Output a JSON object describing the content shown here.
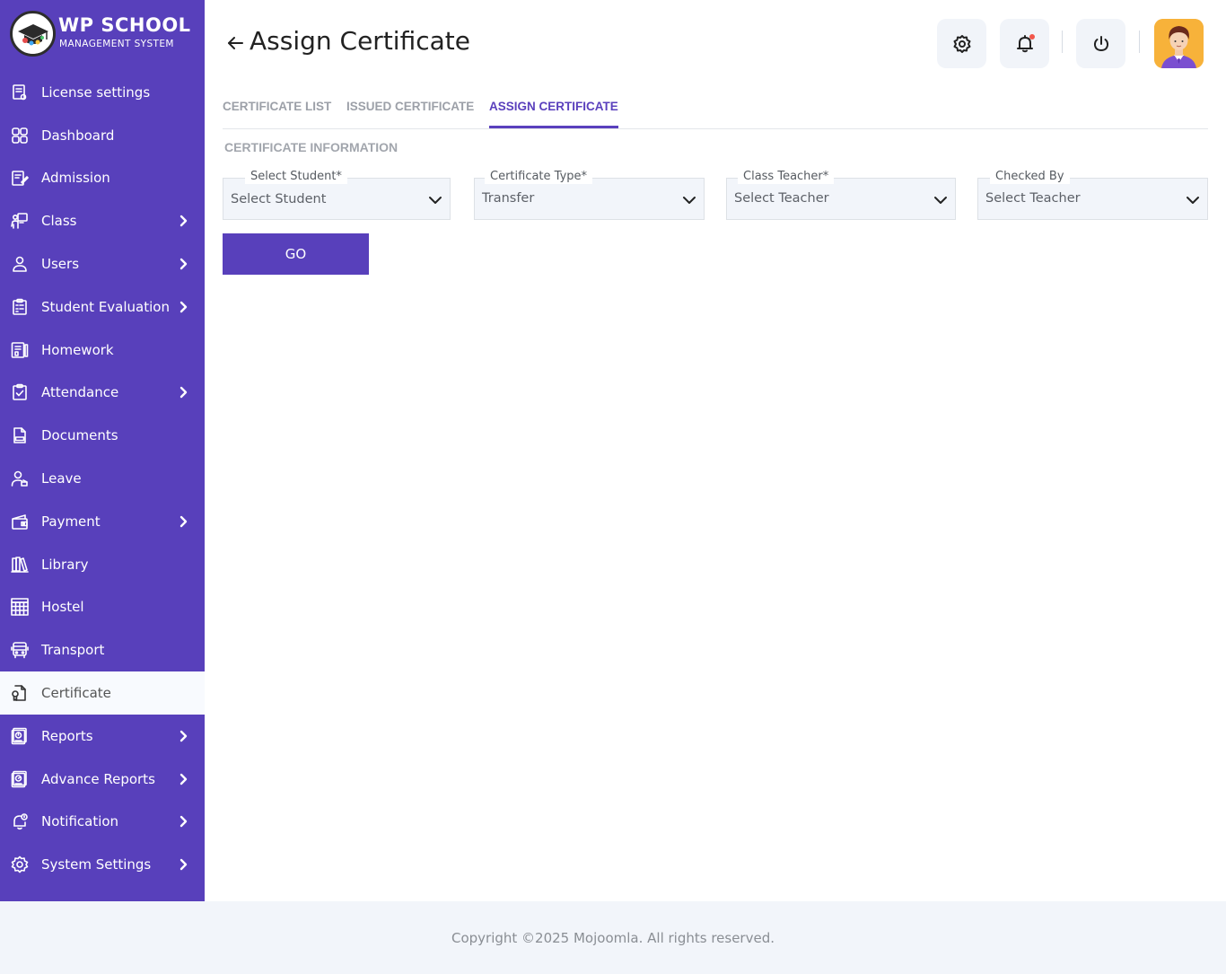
{
  "brand": {
    "title": "WP SCHOOL",
    "subtitle": "MANAGEMENT SYSTEM"
  },
  "sidebar": {
    "items": [
      {
        "label": "License settings",
        "icon": "license-icon",
        "has_submenu": false
      },
      {
        "label": "Dashboard",
        "icon": "dashboard-icon",
        "has_submenu": false
      },
      {
        "label": "Admission",
        "icon": "admission-icon",
        "has_submenu": false
      },
      {
        "label": "Class",
        "icon": "class-icon",
        "has_submenu": true
      },
      {
        "label": "Users",
        "icon": "user-icon",
        "has_submenu": true
      },
      {
        "label": "Student Evaluation",
        "icon": "evaluation-icon",
        "has_submenu": true
      },
      {
        "label": "Homework",
        "icon": "homework-icon",
        "has_submenu": false
      },
      {
        "label": "Attendance",
        "icon": "attendance-icon",
        "has_submenu": true
      },
      {
        "label": "Documents",
        "icon": "document-icon",
        "has_submenu": false
      },
      {
        "label": "Leave",
        "icon": "leave-icon",
        "has_submenu": false
      },
      {
        "label": "Payment",
        "icon": "wallet-icon",
        "has_submenu": true
      },
      {
        "label": "Library",
        "icon": "library-icon",
        "has_submenu": false
      },
      {
        "label": "Hostel",
        "icon": "hostel-icon",
        "has_submenu": false
      },
      {
        "label": "Transport",
        "icon": "bus-icon",
        "has_submenu": false
      },
      {
        "label": "Certificate",
        "icon": "certificate-icon",
        "has_submenu": false,
        "active": true
      },
      {
        "label": "Reports",
        "icon": "report-icon",
        "has_submenu": true
      },
      {
        "label": "Advance Reports",
        "icon": "advance-report-icon",
        "has_submenu": true
      },
      {
        "label": "Notification",
        "icon": "notification-icon",
        "has_submenu": true
      },
      {
        "label": "System Settings",
        "icon": "settings-icon",
        "has_submenu": true
      }
    ]
  },
  "header": {
    "title": "Assign Certificate",
    "icons": [
      "settings-icon",
      "bell-icon",
      "power-icon",
      "avatar"
    ]
  },
  "tabs": [
    {
      "label": "CERTIFICATE LIST",
      "active": false
    },
    {
      "label": "ISSUED CERTIFICATE",
      "active": false
    },
    {
      "label": "ASSIGN CERTIFICATE",
      "active": true
    }
  ],
  "form": {
    "section_title": "CERTIFICATE INFORMATION",
    "fields": [
      {
        "label": "Select Student*",
        "value": "Select Student"
      },
      {
        "label": "Certificate Type*",
        "value": "Transfer"
      },
      {
        "label": "Class Teacher*",
        "value": "Select Teacher"
      },
      {
        "label": "Checked By",
        "value": "Select Teacher"
      }
    ],
    "submit_label": "GO"
  },
  "footer": {
    "text": "Copyright ©2025 Mojoomla. All rights reserved."
  },
  "colors": {
    "sidebar": "#5840bb",
    "accent": "#5a40bd",
    "field_bg": "#f2f5fa",
    "footer_bg": "#f2f5fa"
  }
}
